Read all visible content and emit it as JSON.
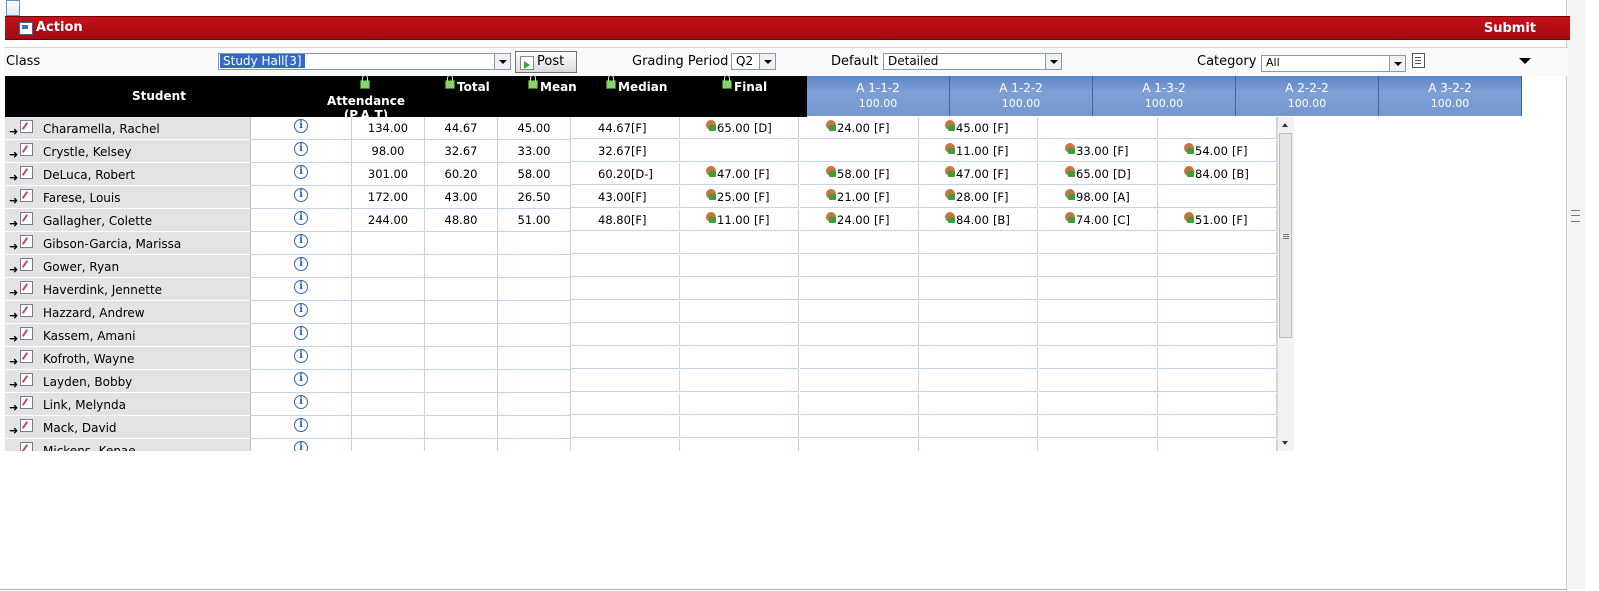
{
  "toolbar": {
    "action_label": "Action",
    "submit_label": "Submit"
  },
  "filters": {
    "class_label": "Class",
    "class_value": "Study Hall[3]",
    "post_label": "Post",
    "grading_period_label": "Grading Period",
    "grading_period_value": "Q2",
    "default_label": "Default",
    "default_value": "Detailed",
    "category_label": "Category",
    "category_value": "All"
  },
  "header": {
    "student": "Student",
    "attendance": "Attendance",
    "attendance_sub": "(P,A,T)",
    "total": "Total",
    "mean": "Mean",
    "median": "Median",
    "final": "Final",
    "assignments": [
      {
        "name": "A 1-1-2",
        "max": "100.00"
      },
      {
        "name": "A 1-2-2",
        "max": "100.00"
      },
      {
        "name": "A 1-3-2",
        "max": "100.00"
      },
      {
        "name": "A 2-2-2",
        "max": "100.00"
      },
      {
        "name": "A 3-2-2",
        "max": "100.00"
      }
    ]
  },
  "students": [
    {
      "name": "Charamella, Rachel",
      "attendance": "134.00",
      "total": "44.67",
      "mean": "45.00",
      "median": "44.67",
      "median_grade": "[F]",
      "scores": [
        {
          "v": "65.00",
          "g": "[D]"
        },
        {
          "v": "24.00",
          "g": "[F]"
        },
        {
          "v": "45.00",
          "g": "[F]"
        },
        null,
        null
      ]
    },
    {
      "name": "Crystle, Kelsey",
      "attendance": "98.00",
      "total": "32.67",
      "mean": "33.00",
      "median": "32.67",
      "median_grade": "[F]",
      "scores": [
        null,
        null,
        {
          "v": "11.00",
          "g": "[F]"
        },
        {
          "v": "33.00",
          "g": "[F]"
        },
        {
          "v": "54.00",
          "g": "[F]"
        }
      ]
    },
    {
      "name": "DeLuca, Robert",
      "attendance": "301.00",
      "total": "60.20",
      "mean": "58.00",
      "median": "60.20",
      "median_grade": "[D-]",
      "scores": [
        {
          "v": "47.00",
          "g": "[F]"
        },
        {
          "v": "58.00",
          "g": "[F]"
        },
        {
          "v": "47.00",
          "g": "[F]"
        },
        {
          "v": "65.00",
          "g": "[D]"
        },
        {
          "v": "84.00",
          "g": "[B]"
        }
      ]
    },
    {
      "name": "Farese, Louis",
      "attendance": "172.00",
      "total": "43.00",
      "mean": "26.50",
      "median": "43.00",
      "median_grade": "[F]",
      "scores": [
        {
          "v": "25.00",
          "g": "[F]"
        },
        {
          "v": "21.00",
          "g": "[F]"
        },
        {
          "v": "28.00",
          "g": "[F]"
        },
        {
          "v": "98.00",
          "g": "[A]"
        },
        null
      ]
    },
    {
      "name": "Gallagher, Colette",
      "attendance": "244.00",
      "total": "48.80",
      "mean": "51.00",
      "median": "48.80",
      "median_grade": "[F]",
      "scores": [
        {
          "v": "11.00",
          "g": "[F]"
        },
        {
          "v": "24.00",
          "g": "[F]"
        },
        {
          "v": "84.00",
          "g": "[B]"
        },
        {
          "v": "74.00",
          "g": "[C]"
        },
        {
          "v": "51.00",
          "g": "[F]"
        }
      ]
    },
    {
      "name": "Gibson-Garcia, Marissa",
      "attendance": "",
      "total": "",
      "mean": "",
      "median": "",
      "median_grade": "",
      "scores": [
        null,
        null,
        null,
        null,
        null
      ]
    },
    {
      "name": "Gower, Ryan",
      "attendance": "",
      "total": "",
      "mean": "",
      "median": "",
      "median_grade": "",
      "scores": [
        null,
        null,
        null,
        null,
        null
      ]
    },
    {
      "name": "Haverdink, Jennette",
      "attendance": "",
      "total": "",
      "mean": "",
      "median": "",
      "median_grade": "",
      "scores": [
        null,
        null,
        null,
        null,
        null
      ]
    },
    {
      "name": "Hazzard, Andrew",
      "attendance": "",
      "total": "",
      "mean": "",
      "median": "",
      "median_grade": "",
      "scores": [
        null,
        null,
        null,
        null,
        null
      ]
    },
    {
      "name": "Kassem, Amani",
      "attendance": "",
      "total": "",
      "mean": "",
      "median": "",
      "median_grade": "",
      "scores": [
        null,
        null,
        null,
        null,
        null
      ]
    },
    {
      "name": "Kofroth, Wayne",
      "attendance": "",
      "total": "",
      "mean": "",
      "median": "",
      "median_grade": "",
      "scores": [
        null,
        null,
        null,
        null,
        null
      ]
    },
    {
      "name": "Layden, Bobby",
      "attendance": "",
      "total": "",
      "mean": "",
      "median": "",
      "median_grade": "",
      "scores": [
        null,
        null,
        null,
        null,
        null
      ]
    },
    {
      "name": "Link, Melynda",
      "attendance": "",
      "total": "",
      "mean": "",
      "median": "",
      "median_grade": "",
      "scores": [
        null,
        null,
        null,
        null,
        null
      ]
    },
    {
      "name": "Mack, David",
      "attendance": "",
      "total": "",
      "mean": "",
      "median": "",
      "median_grade": "",
      "scores": [
        null,
        null,
        null,
        null,
        null
      ]
    },
    {
      "name": "Mickens, Kenae",
      "attendance": "",
      "total": "",
      "mean": "",
      "median": "",
      "median_grade": "",
      "scores": [
        null,
        null,
        null,
        null,
        null
      ]
    }
  ]
}
